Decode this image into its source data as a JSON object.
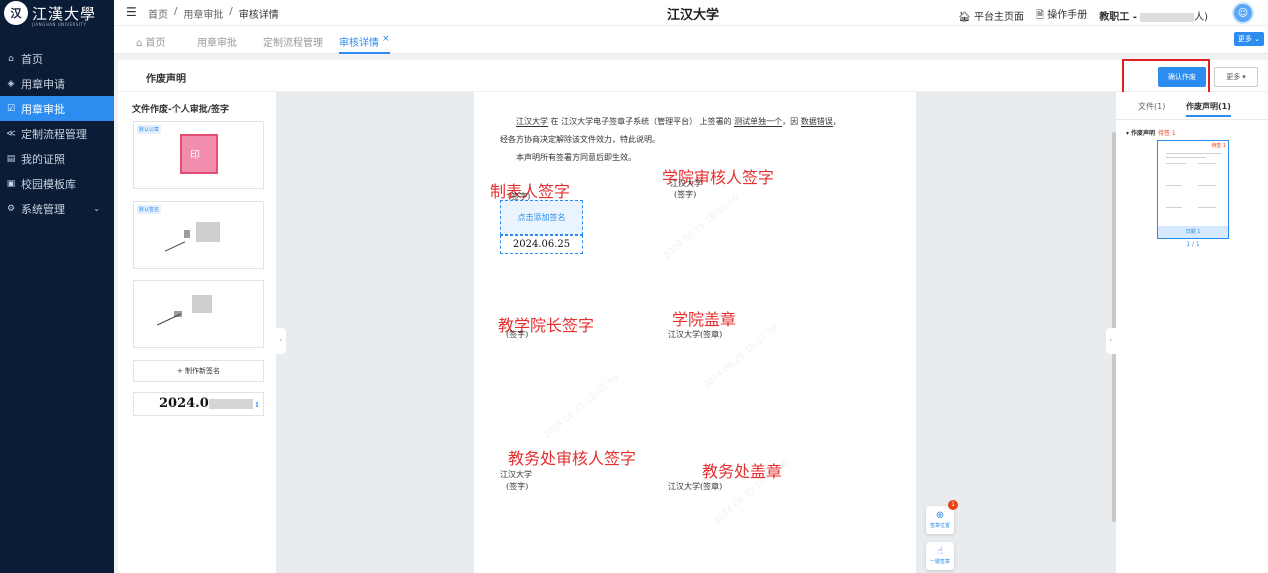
{
  "sidebar": {
    "logo_text": "江漢大學",
    "logo_sub": "JIANGHAN UNIVERSITY",
    "items": [
      {
        "label": "首页",
        "icon": "home-icon"
      },
      {
        "label": "用章申请",
        "icon": "diamond-icon"
      },
      {
        "label": "用章审批",
        "icon": "approve-icon",
        "active": true
      },
      {
        "label": "定制流程管理",
        "icon": "share-icon"
      },
      {
        "label": "我的证照",
        "icon": "doc-icon"
      },
      {
        "label": "校园模板库",
        "icon": "template-icon"
      },
      {
        "label": "系统管理",
        "icon": "gear-icon"
      }
    ]
  },
  "header": {
    "breadcrumb": [
      "首页",
      "用章审批",
      "审核详情"
    ],
    "app_title": "江汉大学",
    "platform_link": "平台主页面",
    "manual_link": "操作手册",
    "user_prefix": "教职工 -",
    "user_suffix": "人)"
  },
  "tabs": {
    "items": [
      "首页",
      "用章审批",
      "定制流程管理",
      "审核详情"
    ],
    "more": "更多"
  },
  "content": {
    "title": "作废声明",
    "confirm_button": "确认作废",
    "more_button": "更多 ▾"
  },
  "sig_panel": {
    "title": "文件作废-个人审批/签字",
    "card1_tag": "默认公章",
    "card2_tag": "默认签名",
    "stamp_text": "印",
    "add_button": "+ 制作新签名",
    "date_prefix": "2024.0",
    "badge": "1"
  },
  "document": {
    "line1": {
      "org": "江汉大学",
      "mid": " 在 江汉大学电子签章子系统（管理平台） 上签署的 ",
      "file": "测试单独一个",
      "mid2": "，因 ",
      "reason": "数据错误",
      "end": "，"
    },
    "line2": "经各方协商决定解除该文件效力，特此说明。",
    "line3": "本声明所有签署方同意后即生效。",
    "labels": {
      "maker": "制表人签字",
      "college_reviewer": "学院审核人签字",
      "dean": "教学院长签字",
      "college_seal": "学院盖章",
      "academic_reviewer": "教务处审核人签字",
      "academic_seal": "教务处盖章"
    },
    "sig_texts": {
      "maker_sign": "(签字)",
      "college_org": "江汉大学",
      "college_sign": "(签字)",
      "dean_sign": "(签字)",
      "college_seal_text": "江汉大学(签章)",
      "academic_org": "江汉大学",
      "academic_sign": "(签字)",
      "academic_seal_text": "江汉大学(签章)"
    },
    "add_sign": "点击添加签名",
    "date": "2024.06.25"
  },
  "floating": {
    "position_label": "签章位置",
    "position_badge": "1",
    "one_click_label": "一键签章"
  },
  "right_panel": {
    "tab_files": "文件(1)",
    "tab_void": "作废声明(1)",
    "tree_item": "作废声明",
    "pending": "待签 1",
    "thumb_tag": "待签 1",
    "thumb_foot": "日期 1",
    "page_count": "1 / 1"
  }
}
